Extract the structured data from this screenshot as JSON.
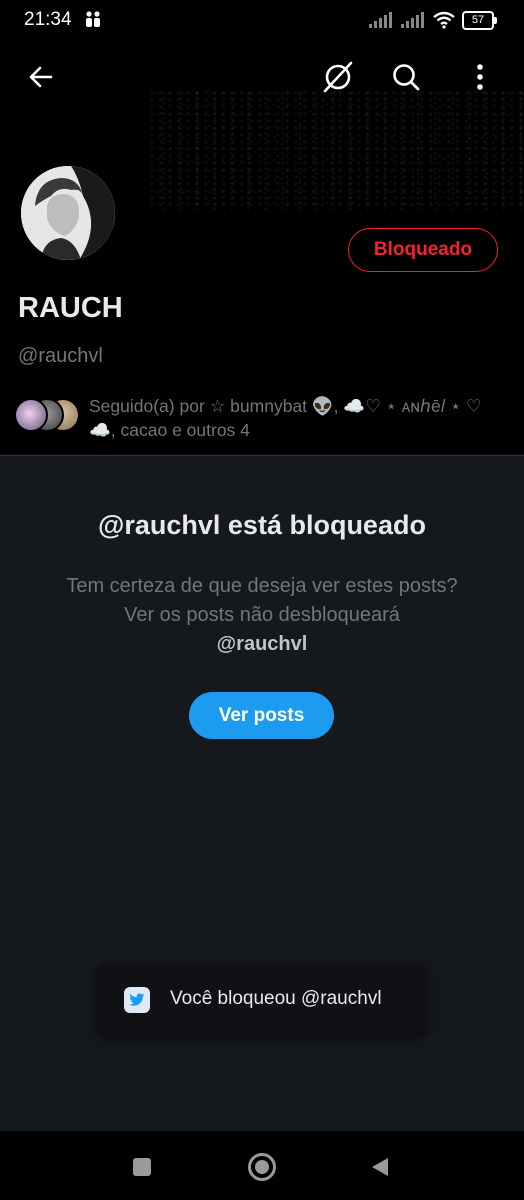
{
  "status_bar": {
    "time": "21:34",
    "battery": "57",
    "icons": [
      "teams-icon",
      "signal-icon",
      "signal-icon",
      "wifi-icon",
      "battery-icon"
    ]
  },
  "nav": {
    "icons": [
      "back-arrow-icon",
      "blocked-circle-icon",
      "search-icon",
      "more-vert-icon"
    ]
  },
  "profile": {
    "display_name": "RAUCH",
    "handle": "@rauchvl",
    "blocked_label": "Bloqueado",
    "followed_by": "Seguido(a) por ☆ bumnybat 👽, ☁️♡ ⋆ ᴀɴℎē𝑙 ⋆ ♡ ☁️, cacao e outros 4"
  },
  "blocked": {
    "title": "@rauchvl está bloqueado",
    "desc_text": "Tem certeza de que deseja ver estes posts? Ver os posts não desbloqueará",
    "desc_handle": "@rauchvl",
    "view_button": "Ver posts"
  },
  "toast": {
    "text": "Você bloqueou @rauchvl"
  },
  "system_nav": {
    "icons": [
      "recents-square-icon",
      "home-circle-icon",
      "back-triangle-icon"
    ]
  },
  "colors": {
    "accent": "#1d9bf0",
    "blocked_red": "#f4212e",
    "background": "#15181c"
  }
}
